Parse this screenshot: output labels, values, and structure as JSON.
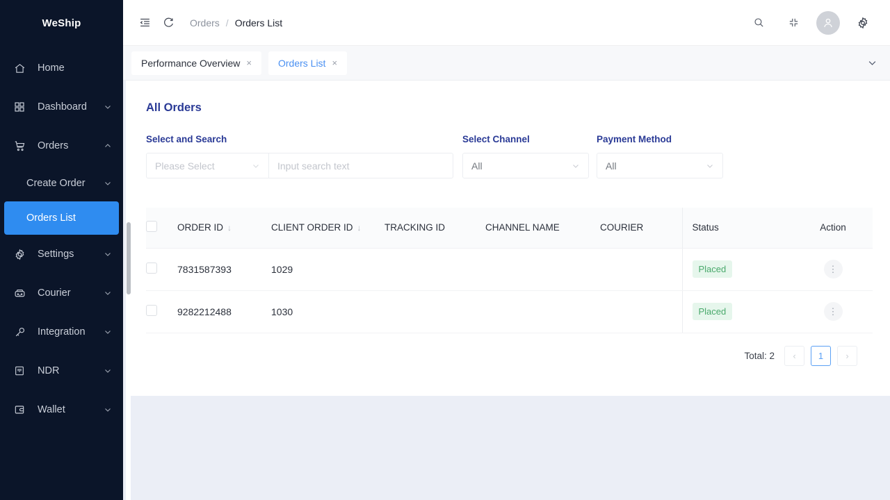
{
  "sidebar": {
    "brand": "WeShip",
    "items": [
      {
        "label": "Home",
        "icon": "home-icon",
        "chevron": ""
      },
      {
        "label": "Dashboard",
        "icon": "grid-icon",
        "chevron": "⌄"
      },
      {
        "label": "Orders",
        "icon": "cart-icon",
        "chevron": "⌃"
      },
      {
        "label": "Settings",
        "icon": "gear-icon",
        "chevron": "⌄"
      },
      {
        "label": "Courier",
        "icon": "truck-icon",
        "chevron": "⌄"
      },
      {
        "label": "Integration",
        "icon": "plug-icon",
        "chevron": "⌄"
      },
      {
        "label": "NDR",
        "icon": "document-icon",
        "chevron": "⌄"
      },
      {
        "label": "Wallet",
        "icon": "wallet-icon",
        "chevron": "⌄"
      }
    ],
    "sub_items": [
      {
        "label": "Create Order",
        "chevron": "⌄",
        "active": false
      },
      {
        "label": "Orders List",
        "chevron": "",
        "active": true
      }
    ]
  },
  "topbar": {
    "menu_fold_icon": "menu-fold-icon",
    "refresh_icon": "refresh-icon",
    "breadcrumb": {
      "parent": "Orders",
      "separator": "/",
      "current": "Orders List"
    },
    "search_icon": "search-icon",
    "fullscreen_icon": "fullscreen-icon",
    "avatar_icon": "user-avatar-icon",
    "settings_icon": "settings-gear-icon"
  },
  "tabs": {
    "items": [
      {
        "label": "Performance Overview",
        "close": "×",
        "active": false
      },
      {
        "label": "Orders List",
        "close": "×",
        "active": true
      }
    ],
    "chevron": "⌄"
  },
  "panel": {
    "title": "All Orders",
    "filters": [
      {
        "label": "Select and Search",
        "select_value": "Please Select",
        "input_placeholder": "Input search text"
      },
      {
        "label": "Select Channel",
        "select_value": "All"
      },
      {
        "label": "Payment Method",
        "select_value": "All"
      }
    ]
  },
  "table": {
    "columns": [
      {
        "label": "ORDER ID",
        "sortable": true
      },
      {
        "label": "CLIENT ORDER ID",
        "sortable": true
      },
      {
        "label": "TRACKING ID",
        "sortable": false
      },
      {
        "label": "CHANNEL NAME",
        "sortable": false
      },
      {
        "label": "COURIER",
        "sortable": false
      },
      {
        "label": "Status",
        "sortable": false
      },
      {
        "label": "Action",
        "sortable": false
      }
    ],
    "sort_glyph": "↓",
    "rows": [
      {
        "order_id": "7831587393",
        "client_order_id": "1029",
        "tracking_id": "",
        "channel_name": "",
        "courier": "",
        "status": "Placed",
        "action": "⋮"
      },
      {
        "order_id": "9282212488",
        "client_order_id": "1030",
        "tracking_id": "",
        "channel_name": "",
        "courier": "",
        "status": "Placed",
        "action": "⋮"
      }
    ]
  },
  "pagination": {
    "total_label": "Total: 2",
    "prev": "‹",
    "current_page": "1",
    "next": "›"
  },
  "colors": {
    "sidebar_bg": "#0b1529",
    "active_nav": "#2f8cf0",
    "accent_title": "#2a3a96",
    "tab_active": "#4a90f2",
    "status_green_text": "#4aa96c",
    "status_green_bg": "#e6f6ec",
    "page_bg": "#ebeef6"
  }
}
